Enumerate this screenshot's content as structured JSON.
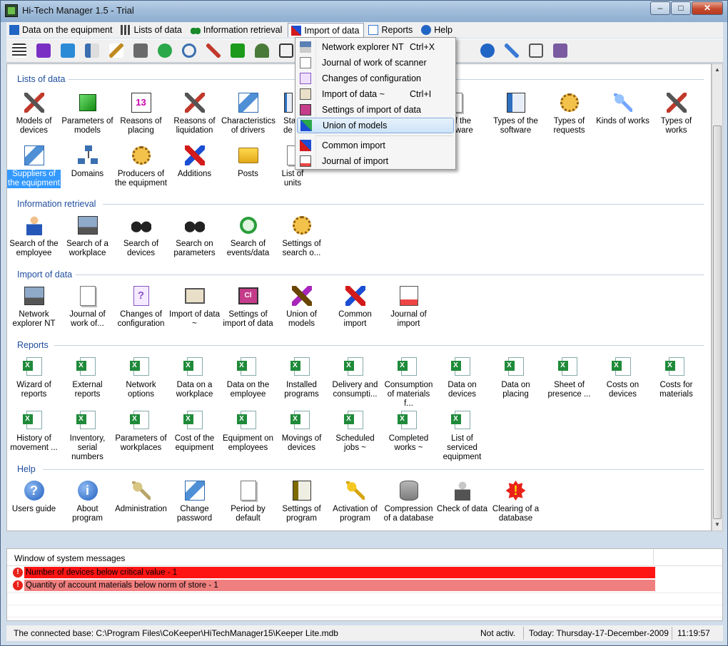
{
  "window": {
    "title": "Hi-Tech Manager 1.5 - Trial",
    "minimize": "–",
    "maximize": "□",
    "close": "✕"
  },
  "menubar": [
    {
      "label": "Data on the equipment",
      "icon": "cube-icon",
      "color": "#2166c4"
    },
    {
      "label": "Lists of data",
      "icon": "grid-icon",
      "color": "#444444"
    },
    {
      "label": "Information retrieval",
      "icon": "binoculars-icon",
      "color": "#1a8a2a"
    },
    {
      "label": "Import of data",
      "icon": "import-icon",
      "color": "#d31b1b"
    },
    {
      "label": "Reports",
      "icon": "report-icon",
      "color": "#3a7bd5"
    },
    {
      "label": "Help",
      "icon": "help-icon",
      "color": "#2166c4"
    }
  ],
  "toolbar": [
    {
      "icon": "tree-icon",
      "color": "#333333"
    },
    {
      "icon": "purple-cube-icon",
      "color": "#7a2fc4"
    },
    {
      "icon": "blue-cube-icon",
      "color": "#2a8ad6"
    },
    {
      "icon": "book-icon",
      "color": "#3a6fb0"
    },
    {
      "icon": "pencil-icon",
      "color": "#c08a20"
    },
    {
      "icon": "device-icon",
      "color": "#6a6a6a"
    },
    {
      "icon": "check-icon",
      "color": "#2aa84a"
    },
    {
      "icon": "search-icon",
      "color": "#3a6fb0"
    },
    {
      "icon": "tools-icon",
      "color": "#c0392b"
    },
    {
      "icon": "green-cube-icon",
      "color": "#1b9a1b"
    },
    {
      "icon": "hat-icon",
      "color": "#4a7a3a"
    },
    {
      "icon": "monitor-icon",
      "color": "#333333"
    },
    {
      "icon": "info-icon",
      "color": "#2166c4"
    },
    {
      "icon": "key-icon",
      "color": "#3a7bd5"
    },
    {
      "icon": "period-icon",
      "color": "#555555"
    },
    {
      "icon": "settings-icon",
      "color": "#7a5aa0"
    }
  ],
  "dropdown": {
    "items": [
      {
        "label": "Network explorer NT",
        "shortcut": "Ctrl+X",
        "icon": "network-icon"
      },
      {
        "label": "Journal of work of scanner",
        "shortcut": "",
        "icon": "journal-icon"
      },
      {
        "label": "Changes of configuration",
        "shortcut": "",
        "icon": "config-icon"
      },
      {
        "label": "Import of data ~",
        "shortcut": "Ctrl+I",
        "icon": "import-icon"
      },
      {
        "label": "Settings of import of data",
        "shortcut": "",
        "icon": "settings-icon"
      },
      {
        "label": "Union of models",
        "shortcut": "",
        "icon": "union-icon"
      },
      {
        "label": "Common import",
        "shortcut": "",
        "icon": "common-import-icon"
      },
      {
        "label": "Journal of import",
        "shortcut": "",
        "icon": "journal-import-icon"
      }
    ],
    "highlighted": "Union of models"
  },
  "sections": {
    "lists": {
      "title": "Lists of data",
      "row1": [
        {
          "l1": "Models of",
          "l2": "devices"
        },
        {
          "l1": "Parameters of",
          "l2": "models"
        },
        {
          "l1": "Reasons of",
          "l2": "placing"
        },
        {
          "l1": "Reasons of",
          "l2": "liquidation"
        },
        {
          "l1": "Characteristics",
          "l2": "of drivers"
        },
        {
          "l1": "Sta",
          "l2": "de"
        },
        {
          "l1": "",
          "l2": ""
        },
        {
          "l1": "",
          "l2": ""
        },
        {
          "l1": "Types of",
          "l2": "the software"
        },
        {
          "l1": "t of the",
          "l2": "oftware"
        },
        {
          "l1": "Types of the",
          "l2": "software"
        },
        {
          "l1": "Types of",
          "l2": "requests"
        },
        {
          "l1": "Kinds of works",
          "l2": ""
        },
        {
          "l1": "Types of",
          "l2": "works"
        }
      ],
      "row2": [
        {
          "l1": "Suppliers of",
          "l2": "the equipment"
        },
        {
          "l1": "Domains",
          "l2": ""
        },
        {
          "l1": "Producers of",
          "l2": "the equipment"
        },
        {
          "l1": "Additions",
          "l2": ""
        },
        {
          "l1": "Posts",
          "l2": ""
        },
        {
          "l1": "List of units",
          "l2": ""
        }
      ]
    },
    "retrieval": {
      "title": "Information retrieval",
      "items": [
        {
          "l1": "Search of the",
          "l2": "employee"
        },
        {
          "l1": "Search of a",
          "l2": "workplace"
        },
        {
          "l1": "Search of",
          "l2": "devices"
        },
        {
          "l1": "Search on",
          "l2": "parameters"
        },
        {
          "l1": "Search of",
          "l2": "events/data"
        },
        {
          "l1": "Settings of",
          "l2": "search o..."
        }
      ]
    },
    "import": {
      "title": "Import of data",
      "items": [
        {
          "l1": "Network",
          "l2": "explorer NT"
        },
        {
          "l1": "Journal of",
          "l2": "work of..."
        },
        {
          "l1": "Changes of",
          "l2": "configuration"
        },
        {
          "l1": "Import of data",
          "l2": "~"
        },
        {
          "l1": "Settings of",
          "l2": "import of data"
        },
        {
          "l1": "Union of",
          "l2": "models"
        },
        {
          "l1": "Common",
          "l2": "import"
        },
        {
          "l1": "Journal of",
          "l2": "import"
        }
      ]
    },
    "reports": {
      "title": "Reports",
      "row1": [
        {
          "l1": "Wizard of",
          "l2": "reports"
        },
        {
          "l1": "External",
          "l2": "reports"
        },
        {
          "l1": "Network",
          "l2": "options"
        },
        {
          "l1": "Data on a",
          "l2": "workplace"
        },
        {
          "l1": "Data on the",
          "l2": "employee"
        },
        {
          "l1": "Installed",
          "l2": "programs"
        },
        {
          "l1": "Delivery and",
          "l2": "consumpti..."
        },
        {
          "l1": "Consumption",
          "l2": "of materials f..."
        },
        {
          "l1": "Data on",
          "l2": "devices"
        },
        {
          "l1": "Data on",
          "l2": "placing"
        },
        {
          "l1": "Sheet of",
          "l2": "presence ..."
        },
        {
          "l1": "Costs on",
          "l2": "devices"
        },
        {
          "l1": "Costs for",
          "l2": "materials"
        }
      ],
      "row2": [
        {
          "l1": "History of",
          "l2": "movement ..."
        },
        {
          "l1": "Inventory,",
          "l2": "serial numbers"
        },
        {
          "l1": "Parameters of",
          "l2": "workplaces"
        },
        {
          "l1": "Cost of the",
          "l2": "equipment"
        },
        {
          "l1": "Equipment on",
          "l2": "employees"
        },
        {
          "l1": "Movings of",
          "l2": "devices"
        },
        {
          "l1": "Scheduled",
          "l2": "jobs ~"
        },
        {
          "l1": "Completed",
          "l2": "works ~"
        },
        {
          "l1": "List of serviced",
          "l2": "equipment"
        }
      ]
    },
    "help": {
      "title": "Help",
      "items": [
        {
          "l1": "Users guide",
          "l2": ""
        },
        {
          "l1": "About program",
          "l2": ""
        },
        {
          "l1": "Administration",
          "l2": ""
        },
        {
          "l1": "Change",
          "l2": "password"
        },
        {
          "l1": "Period by",
          "l2": "default"
        },
        {
          "l1": "Settings of",
          "l2": "program"
        },
        {
          "l1": "Activation of",
          "l2": "program"
        },
        {
          "l1": "Compression",
          "l2": "of a database"
        },
        {
          "l1": "Check of data",
          "l2": ""
        },
        {
          "l1": "Clearing of a",
          "l2": "database"
        }
      ]
    }
  },
  "messages": {
    "title": "Window of system messages",
    "items": [
      {
        "text": "Number of devices below critical value - 1",
        "color": "#ff1414"
      },
      {
        "text": "Quantity of account materials below norm of store - 1",
        "color": "#f08080"
      }
    ]
  },
  "status": {
    "base": "The connected base: C:\\Program Files\\CoKeeper\\HiTechManager15\\Keeper Lite.mdb",
    "activation": "Not activ.",
    "today": "Today: Thursday-17-December-2009",
    "time": "11:19:57"
  }
}
